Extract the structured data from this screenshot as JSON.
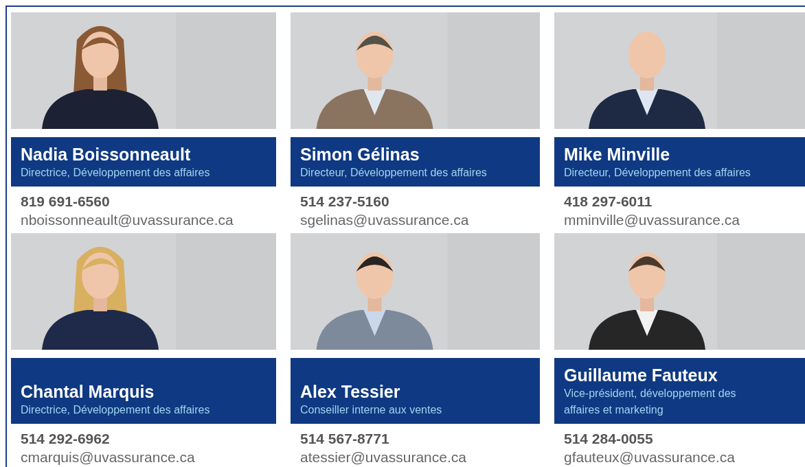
{
  "team": [
    {
      "name": "Nadia Boissonneault",
      "title": "Directrice, Développement des affaires",
      "phone": "819 691-6560",
      "email": "nboissonneault@uvassurance.ca"
    },
    {
      "name": "Simon Gélinas",
      "title": "Directeur, Développement des affaires",
      "phone": "514 237-5160",
      "email": "sgelinas@uvassurance.ca"
    },
    {
      "name": "Mike Minville",
      "title": "Directeur, Développement des affaires",
      "phone": "418 297-6011",
      "email": "mminville@uvassurance.ca"
    },
    {
      "name": "Chantal Marquis",
      "title": "Directrice, Développement des affaires",
      "phone": "514 292-6962",
      "email": "cmarquis@uvassurance.ca"
    },
    {
      "name": "Alex Tessier",
      "title": "Conseiller interne aux ventes",
      "phone": "514 567-8771",
      "email": "atessier@uvassurance.ca"
    },
    {
      "name": "Guillaume Fauteux",
      "title": "Vice-président, développement des affaires et marketing",
      "phone": "514 284-0055",
      "email": "gfauteux@uvassurance.ca"
    }
  ]
}
